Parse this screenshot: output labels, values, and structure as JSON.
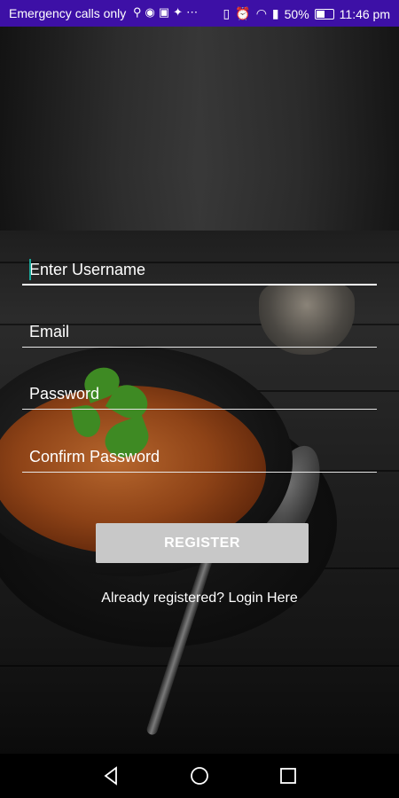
{
  "status_bar": {
    "carrier": "Emergency calls only",
    "battery": "50%",
    "time": "11:46 pm",
    "icons": [
      "usb-icon",
      "messenger-icon",
      "instagram-icon",
      "twitter-icon",
      "more-icon",
      "vibrate-icon",
      "alarm-icon",
      "wifi-icon",
      "signal-icon",
      "battery-icon"
    ]
  },
  "form": {
    "username_placeholder": "Enter Username",
    "email_placeholder": "Email",
    "password_placeholder": "Password",
    "confirm_password_placeholder": "Confirm Password",
    "register_label": "REGISTER",
    "login_link": "Already registered? Login Here"
  },
  "colors": {
    "status_bar": "#3d10a6",
    "cursor": "#1aa79a",
    "button": "#c8c8c8"
  },
  "nav_bar": {
    "icons": [
      "back-icon",
      "home-icon",
      "recents-icon"
    ]
  }
}
